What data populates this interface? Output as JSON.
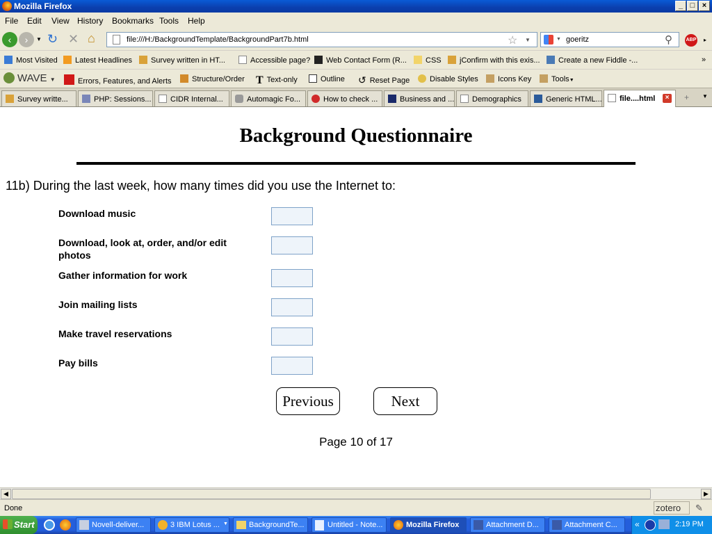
{
  "window": {
    "title": "Mozilla Firefox"
  },
  "menu": [
    "File",
    "Edit",
    "View",
    "History",
    "Bookmarks",
    "Tools",
    "Help"
  ],
  "nav": {
    "url": "file:///H:/BackgroundTemplate/BackgroundPart7b.html",
    "search_value": "goeritz",
    "abp": "ABP"
  },
  "bookmarks": [
    "Most Visited",
    "Latest Headlines",
    "Survey written in HT...",
    "Accessible page?",
    "Web Contact Form (R...",
    "CSS",
    "jConfirm with this exis...",
    "Create a new Fiddle -..."
  ],
  "wave": {
    "logo": "WAVE",
    "items": [
      "Errors, Features, and Alerts",
      "Structure/Order",
      "Text-only",
      "Outline",
      "Reset Page",
      "Disable Styles",
      "Icons Key",
      "Tools"
    ]
  },
  "tabs": [
    "Survey writte...",
    "PHP: Sessions...",
    "CIDR Internal...",
    "Automagic Fo...",
    "How to check ...",
    "Business and ...",
    "Demographics",
    "Generic HTML...",
    "file....html"
  ],
  "page": {
    "title": "Background Questionnaire",
    "question": "11b) During the last week, how many times did you use the Internet to:",
    "items": [
      "Download music",
      "Download, look at, order, and/or edit photos",
      "Gather information for work",
      "Join mailing lists",
      "Make travel reservations",
      "Pay bills"
    ],
    "previous": "Previous",
    "next": "Next",
    "page_info": "Page 10 of 17"
  },
  "status": {
    "text": "Done",
    "zotero": "zotero"
  },
  "taskbar": {
    "start": "Start",
    "tasks": [
      "Novell-deliver...",
      "3 IBM Lotus ...",
      "BackgroundTe...",
      "Untitled - Note...",
      "Mozilla Firefox",
      "Attachment D...",
      "Attachment C..."
    ],
    "time": "2:19 PM"
  }
}
